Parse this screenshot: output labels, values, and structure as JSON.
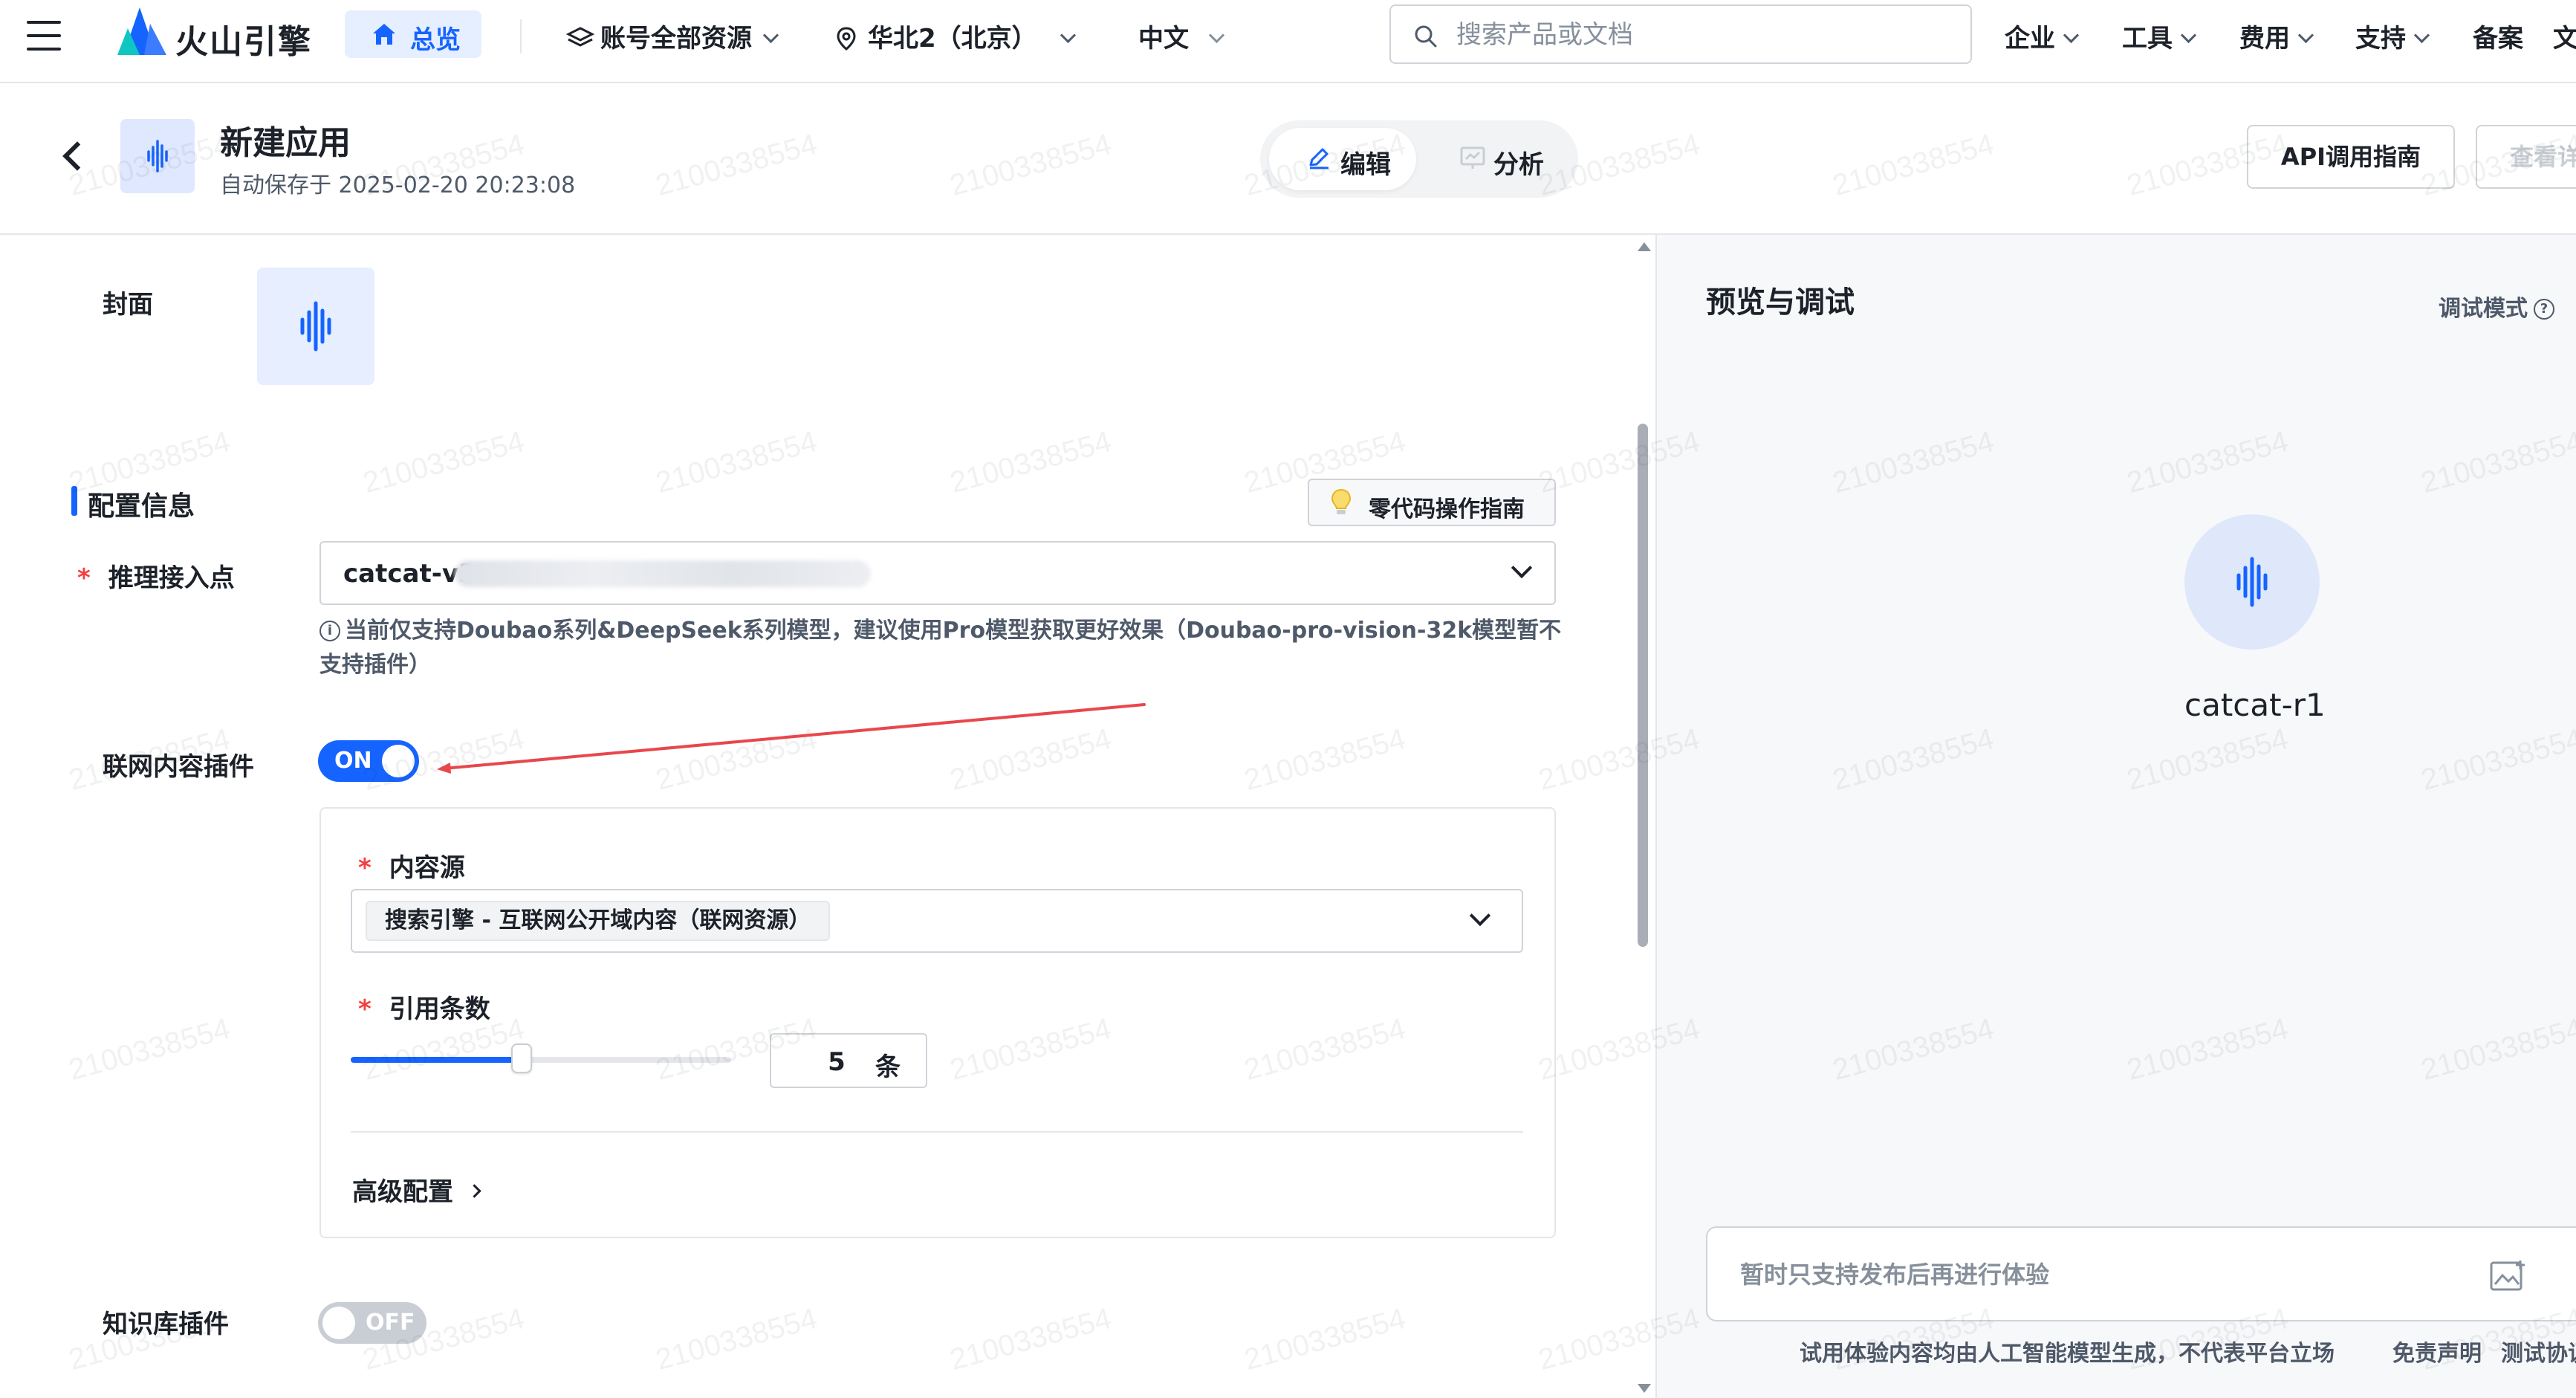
{
  "topnav": {
    "brand": "火山引擎",
    "home": "总览",
    "account": "账号全部资源",
    "region": "华北2（北京）",
    "language": "中文",
    "search_placeholder": "搜索产品或文档",
    "menus": [
      "企业",
      "工具",
      "费用",
      "支持"
    ],
    "filing": "备案",
    "cut_text": "文"
  },
  "app_header": {
    "title": "新建应用",
    "autosave": "自动保存于 2025-02-20 20:23:08",
    "edit_tab": "编辑",
    "analyze_tab": "分析",
    "api_guide": "API调用指南",
    "view_btn": "查看详"
  },
  "config": {
    "cover_label": "封面",
    "section_title": "配置信息",
    "guide_button": "零代码操作指南",
    "endpoint_label": "推理接入点",
    "endpoint_value": "catcat-v3",
    "endpoint_hint": "当前仅支持Doubao系列&DeepSeek系列模型，建议使用Pro模型获取更好效果（Doubao-pro-vision-32k模型暂不支持插件）",
    "web_plugin_label": "联网内容插件",
    "web_plugin_state": "ON",
    "content_source_label": "内容源",
    "content_source_value": "搜索引擎 - 互联网公开域内容（联网资源）",
    "citation_label": "引用条数",
    "citation_slider_fraction": 0.45,
    "citation_count": "5",
    "citation_unit": "条",
    "advanced_label": "高级配置",
    "kb_plugin_label": "知识库插件",
    "kb_plugin_state": "OFF"
  },
  "preview": {
    "title": "预览与调试",
    "debug_mode": "调试模式",
    "bot_name": "catcat-r1",
    "input_placeholder": "暂时只支持发布后再进行体验",
    "disclaimer": "试用体验内容均由人工智能模型生成，不代表平台立场",
    "disclaimer_link": "免责声明",
    "test_link": "测试协议"
  },
  "watermark": "2100338554",
  "colors": {
    "accent": "#1664ff",
    "required": "#f53f3f",
    "annotation_arrow": "#e8474c"
  }
}
